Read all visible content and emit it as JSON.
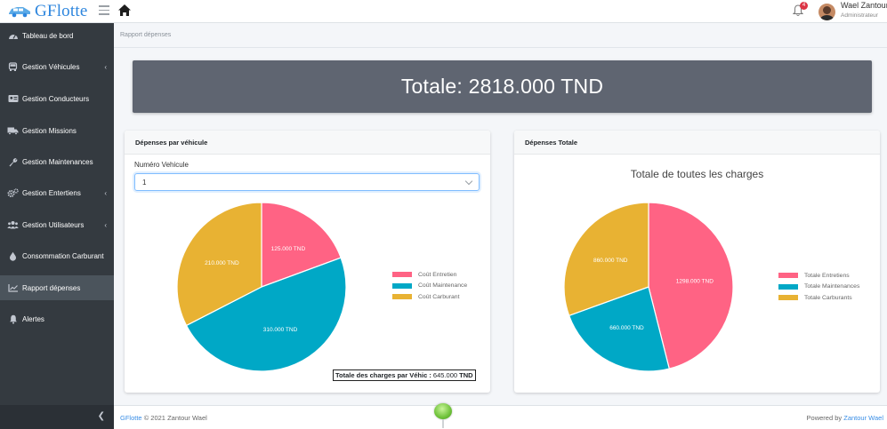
{
  "brand": {
    "name": "GFlotte"
  },
  "user": {
    "name": "Wael Zantour",
    "role": "Administrateur"
  },
  "notifications": {
    "count": "4"
  },
  "sidebar": {
    "items": [
      {
        "label": "Tableau de bord",
        "icon": "dashboard-icon",
        "chevron": false,
        "active": false
      },
      {
        "label": "Gestion Véhicules",
        "icon": "car-icon",
        "chevron": true,
        "active": false
      },
      {
        "label": "Gestion Conducteurs",
        "icon": "id-card-icon",
        "chevron": false,
        "active": false
      },
      {
        "label": "Gestion Missions",
        "icon": "truck-icon",
        "chevron": false,
        "active": false
      },
      {
        "label": "Gestion Maintenances",
        "icon": "wrench-icon",
        "chevron": false,
        "active": false
      },
      {
        "label": "Gestion Entertiens",
        "icon": "gears-icon",
        "chevron": true,
        "active": false
      },
      {
        "label": "Gestion Utilisateurs",
        "icon": "users-icon",
        "chevron": true,
        "active": false
      },
      {
        "label": "Consommation Carburant",
        "icon": "fuel-drop-icon",
        "chevron": false,
        "active": false
      },
      {
        "label": "Rapport dépenses",
        "icon": "chart-icon",
        "chevron": false,
        "active": true
      },
      {
        "label": "Alertes",
        "icon": "bell-icon",
        "chevron": false,
        "active": false
      }
    ]
  },
  "breadcrumb": "Rapport dépenses",
  "banner": {
    "text": "Totale: 2818.000 TND"
  },
  "vehicle_card": {
    "title": "Dépenses par véhicule",
    "field_label": "Numéro Vehicule",
    "selected_value": "1",
    "total_label": "Totale des charges par Véhic :",
    "total_value": "645.000",
    "total_unit": "TND"
  },
  "total_card": {
    "title": "Dépenses Totale",
    "chart_title": "Totale de toutes les charges"
  },
  "footer": {
    "brand_link": "GFlotte",
    "copyright": "© 2021 Zantour Wael",
    "powered_by": "Powered by",
    "powered_link": "Zantour Wael"
  },
  "colors": {
    "entretien": "#ff6384",
    "maintenance": "#00a8c6",
    "carburant": "#e8b233"
  },
  "chart_data": [
    {
      "type": "pie",
      "categories": [
        "Coût Entretien",
        "Coût Maintenance",
        "Coût Carburant"
      ],
      "values": [
        125,
        310,
        210
      ],
      "labels": [
        "125.000 TND",
        "310.000 TND",
        "210.000 TND"
      ],
      "colors": [
        "#ff6384",
        "#00a8c6",
        "#e8b233"
      ],
      "legend": "right"
    },
    {
      "type": "pie",
      "title": "Totale de toutes les charges",
      "categories": [
        "Totale Entretiens",
        "Totale Maintenances",
        "Totale Carburants"
      ],
      "values": [
        1298,
        660,
        860
      ],
      "labels": [
        "1298.000 TND",
        "660.000 TND",
        "860.000 TND"
      ],
      "colors": [
        "#ff6384",
        "#00a8c6",
        "#e8b233"
      ],
      "legend": "right"
    }
  ]
}
